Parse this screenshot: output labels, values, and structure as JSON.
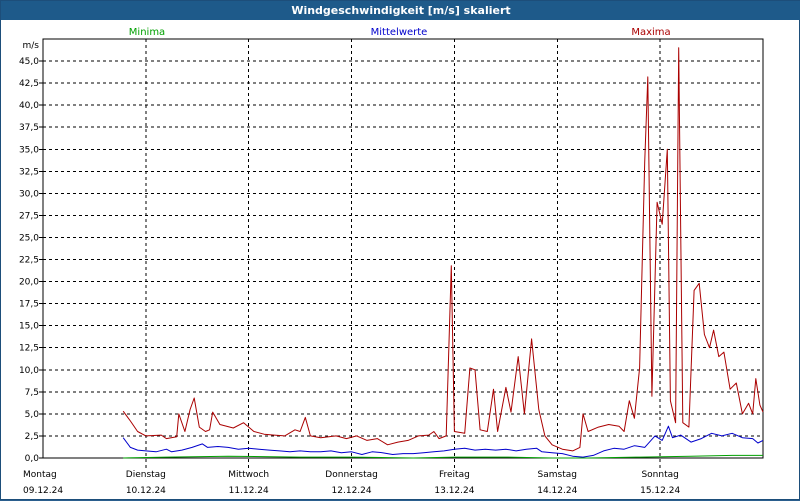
{
  "window": {
    "title": "Windgeschwindigkeit [m/s] skaliert"
  },
  "legend": [
    {
      "label": "Minima",
      "color": "#00a000"
    },
    {
      "label": "Mittelwerte",
      "color": "#0000cc"
    },
    {
      "label": "Maxima",
      "color": "#aa0000"
    }
  ],
  "chart_data": {
    "type": "line",
    "title": "Windgeschwindigkeit [m/s] skaliert",
    "ylabel": "m/s",
    "ylim": [
      0,
      47.5
    ],
    "yticks": [
      0,
      2.5,
      5,
      7.5,
      10,
      12.5,
      15,
      17.5,
      20,
      22.5,
      25,
      27.5,
      30,
      32.5,
      35,
      37.5,
      40,
      42.5,
      45
    ],
    "ytick_labels": [
      "0,0",
      "2,5",
      "5,0",
      "7,5",
      "10,0",
      "12,5",
      "15,0",
      "17,5",
      "20,0",
      "22,5",
      "25,0",
      "27,5",
      "30,0",
      "32,5",
      "35,0",
      "37,5",
      "40,0",
      "42,5",
      "45,0"
    ],
    "xlim": [
      0,
      7
    ],
    "x_ticks": [
      {
        "day": "Montag",
        "date": "09.12.24"
      },
      {
        "day": "Dienstag",
        "date": "10.12.24"
      },
      {
        "day": "Mittwoch",
        "date": "11.12.24"
      },
      {
        "day": "Donnerstag",
        "date": "12.12.24"
      },
      {
        "day": "Freitag",
        "date": "13.12.24"
      },
      {
        "day": "Samstag",
        "date": "14.12.24"
      },
      {
        "day": "Sonntag",
        "date": "15.12.24"
      }
    ],
    "grid": true,
    "legend_position": "top",
    "series": [
      {
        "name": "Minima",
        "color": "#00a000",
        "points": [
          [
            0.78,
            0.0
          ],
          [
            1.2,
            0.1
          ],
          [
            1.8,
            0.2
          ],
          [
            2.5,
            0.1
          ],
          [
            3.0,
            0.1
          ],
          [
            3.6,
            0.0
          ],
          [
            4.0,
            0.1
          ],
          [
            4.5,
            0.1
          ],
          [
            4.95,
            0.0
          ],
          [
            5.3,
            0.0
          ],
          [
            5.8,
            0.1
          ],
          [
            6.3,
            0.2
          ],
          [
            6.7,
            0.3
          ],
          [
            7.0,
            0.3
          ]
        ]
      },
      {
        "name": "Mittelwerte",
        "color": "#0000cc",
        "points": [
          [
            0.78,
            2.3
          ],
          [
            0.85,
            1.2
          ],
          [
            0.92,
            0.9
          ],
          [
            1.0,
            0.8
          ],
          [
            1.1,
            0.7
          ],
          [
            1.2,
            1.0
          ],
          [
            1.25,
            0.7
          ],
          [
            1.35,
            0.9
          ],
          [
            1.45,
            1.2
          ],
          [
            1.55,
            1.6
          ],
          [
            1.6,
            1.2
          ],
          [
            1.7,
            1.3
          ],
          [
            1.8,
            1.2
          ],
          [
            1.9,
            1.0
          ],
          [
            2.0,
            1.1
          ],
          [
            2.1,
            1.0
          ],
          [
            2.2,
            0.9
          ],
          [
            2.3,
            0.8
          ],
          [
            2.4,
            0.7
          ],
          [
            2.5,
            0.8
          ],
          [
            2.6,
            0.7
          ],
          [
            2.7,
            0.7
          ],
          [
            2.8,
            0.8
          ],
          [
            2.9,
            0.6
          ],
          [
            3.0,
            0.7
          ],
          [
            3.1,
            0.4
          ],
          [
            3.2,
            0.7
          ],
          [
            3.3,
            0.6
          ],
          [
            3.4,
            0.4
          ],
          [
            3.5,
            0.5
          ],
          [
            3.6,
            0.5
          ],
          [
            3.7,
            0.6
          ],
          [
            3.8,
            0.7
          ],
          [
            3.9,
            0.8
          ],
          [
            4.0,
            1.0
          ],
          [
            4.1,
            1.1
          ],
          [
            4.2,
            0.9
          ],
          [
            4.3,
            1.0
          ],
          [
            4.4,
            0.9
          ],
          [
            4.5,
            1.0
          ],
          [
            4.6,
            0.8
          ],
          [
            4.7,
            1.0
          ],
          [
            4.8,
            1.1
          ],
          [
            4.85,
            0.7
          ],
          [
            4.95,
            0.6
          ],
          [
            5.05,
            0.5
          ],
          [
            5.15,
            0.2
          ],
          [
            5.25,
            0.1
          ],
          [
            5.35,
            0.3
          ],
          [
            5.45,
            0.8
          ],
          [
            5.55,
            1.1
          ],
          [
            5.65,
            1.0
          ],
          [
            5.75,
            1.4
          ],
          [
            5.85,
            1.2
          ],
          [
            5.95,
            2.5
          ],
          [
            6.02,
            2.0
          ],
          [
            6.08,
            3.6
          ],
          [
            6.12,
            2.3
          ],
          [
            6.2,
            2.6
          ],
          [
            6.3,
            1.8
          ],
          [
            6.4,
            2.2
          ],
          [
            6.5,
            2.8
          ],
          [
            6.6,
            2.5
          ],
          [
            6.7,
            2.8
          ],
          [
            6.8,
            2.3
          ],
          [
            6.9,
            2.2
          ],
          [
            6.95,
            1.7
          ],
          [
            7.0,
            2.0
          ]
        ]
      },
      {
        "name": "Maxima",
        "color": "#aa0000",
        "points": [
          [
            0.78,
            5.3
          ],
          [
            0.85,
            4.2
          ],
          [
            0.92,
            3.0
          ],
          [
            1.0,
            2.5
          ],
          [
            1.15,
            2.6
          ],
          [
            1.2,
            2.2
          ],
          [
            1.3,
            2.4
          ],
          [
            1.32,
            5.0
          ],
          [
            1.38,
            3.0
          ],
          [
            1.43,
            5.5
          ],
          [
            1.47,
            6.8
          ],
          [
            1.52,
            3.5
          ],
          [
            1.58,
            3.0
          ],
          [
            1.62,
            3.2
          ],
          [
            1.65,
            5.2
          ],
          [
            1.72,
            3.8
          ],
          [
            1.85,
            3.4
          ],
          [
            1.95,
            4.0
          ],
          [
            2.05,
            3.0
          ],
          [
            2.15,
            2.7
          ],
          [
            2.25,
            2.6
          ],
          [
            2.35,
            2.5
          ],
          [
            2.45,
            3.2
          ],
          [
            2.5,
            3.0
          ],
          [
            2.55,
            4.6
          ],
          [
            2.6,
            2.5
          ],
          [
            2.7,
            2.3
          ],
          [
            2.85,
            2.5
          ],
          [
            2.95,
            2.2
          ],
          [
            3.05,
            2.5
          ],
          [
            3.15,
            2.0
          ],
          [
            3.25,
            2.2
          ],
          [
            3.35,
            1.5
          ],
          [
            3.45,
            1.8
          ],
          [
            3.55,
            2.0
          ],
          [
            3.65,
            2.5
          ],
          [
            3.75,
            2.6
          ],
          [
            3.8,
            3.0
          ],
          [
            3.85,
            2.2
          ],
          [
            3.92,
            2.5
          ],
          [
            3.97,
            21.8
          ],
          [
            4.0,
            3.0
          ],
          [
            4.1,
            2.8
          ],
          [
            4.15,
            10.2
          ],
          [
            4.2,
            10.0
          ],
          [
            4.25,
            3.2
          ],
          [
            4.32,
            3.0
          ],
          [
            4.38,
            7.8
          ],
          [
            4.42,
            3.0
          ],
          [
            4.5,
            8.0
          ],
          [
            4.55,
            5.2
          ],
          [
            4.62,
            11.5
          ],
          [
            4.68,
            5.0
          ],
          [
            4.75,
            13.5
          ],
          [
            4.82,
            5.5
          ],
          [
            4.88,
            2.5
          ],
          [
            4.95,
            1.5
          ],
          [
            5.05,
            1.0
          ],
          [
            5.15,
            0.8
          ],
          [
            5.22,
            1.2
          ],
          [
            5.25,
            5.0
          ],
          [
            5.3,
            3.0
          ],
          [
            5.4,
            3.5
          ],
          [
            5.5,
            3.8
          ],
          [
            5.6,
            3.6
          ],
          [
            5.65,
            3.0
          ],
          [
            5.7,
            6.5
          ],
          [
            5.75,
            4.5
          ],
          [
            5.8,
            10.2
          ],
          [
            5.85,
            33.5
          ],
          [
            5.88,
            43.2
          ],
          [
            5.92,
            7.0
          ],
          [
            5.97,
            29.0
          ],
          [
            6.02,
            26.5
          ],
          [
            6.07,
            35.0
          ],
          [
            6.1,
            6.5
          ],
          [
            6.15,
            4.0
          ],
          [
            6.18,
            46.5
          ],
          [
            6.22,
            4.0
          ],
          [
            6.28,
            3.5
          ],
          [
            6.33,
            19.0
          ],
          [
            6.38,
            19.8
          ],
          [
            6.43,
            14.0
          ],
          [
            6.48,
            12.5
          ],
          [
            6.52,
            14.5
          ],
          [
            6.57,
            11.5
          ],
          [
            6.62,
            12.0
          ],
          [
            6.68,
            7.8
          ],
          [
            6.74,
            8.5
          ],
          [
            6.8,
            5.0
          ],
          [
            6.86,
            6.2
          ],
          [
            6.9,
            5.0
          ],
          [
            6.93,
            9.0
          ],
          [
            6.97,
            6.0
          ],
          [
            7.0,
            5.2
          ]
        ]
      }
    ]
  }
}
